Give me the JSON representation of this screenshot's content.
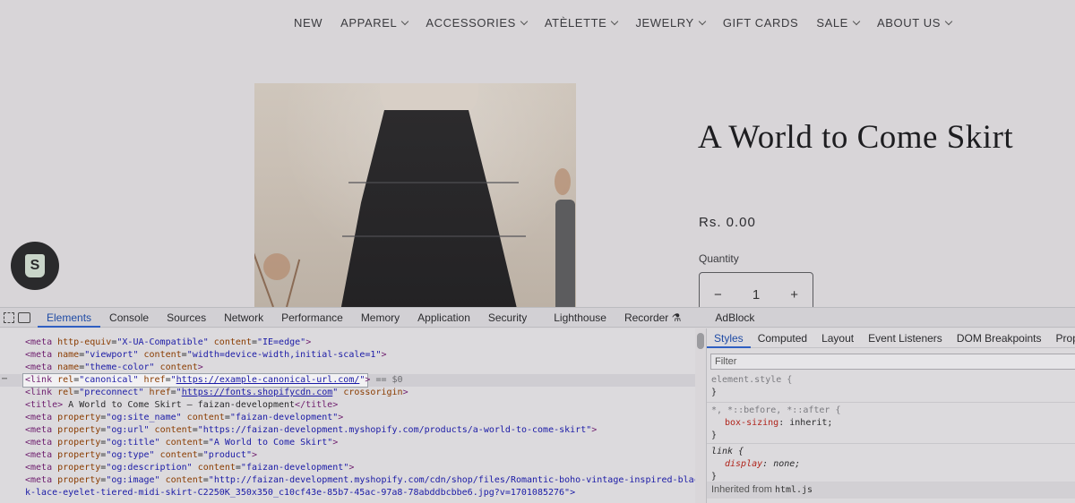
{
  "nav": {
    "items": [
      {
        "label": "NEW",
        "dropdown": false
      },
      {
        "label": "APPAREL",
        "dropdown": true
      },
      {
        "label": "ACCESSORIES",
        "dropdown": true
      },
      {
        "label": "ATÈLETTE",
        "dropdown": true
      },
      {
        "label": "JEWELRY",
        "dropdown": true
      },
      {
        "label": "GIFT CARDS",
        "dropdown": false
      },
      {
        "label": "SALE",
        "dropdown": true
      },
      {
        "label": "ABOUT US",
        "dropdown": true
      }
    ]
  },
  "product": {
    "title": "A World to Come Skirt",
    "price": "Rs. 0.00",
    "quantity_label": "Quantity",
    "quantity_value": "1",
    "minus": "−",
    "plus": "+"
  },
  "devtools": {
    "tabs": [
      "Elements",
      "Console",
      "Sources",
      "Network",
      "Performance",
      "Memory",
      "Application",
      "Security",
      "Lighthouse",
      "Recorder ⚗",
      "AdBlock"
    ],
    "active_tab": "Elements",
    "elements": {
      "lines": [
        {
          "tag": "meta",
          "attrs": [
            [
              "http-equiv",
              "X-UA-Compatible"
            ],
            [
              "content",
              "IE=edge"
            ]
          ]
        },
        {
          "tag": "meta",
          "attrs": [
            [
              "name",
              "viewport"
            ],
            [
              "content",
              "width=device-width,initial-scale=1"
            ]
          ]
        },
        {
          "tag": "meta",
          "attrs": [
            [
              "name",
              "theme-color"
            ],
            [
              "content",
              ""
            ]
          ]
        },
        {
          "tag": "link",
          "attrs": [
            [
              "rel",
              "canonical"
            ],
            [
              "href",
              "https://example-canonical-url.com/"
            ]
          ],
          "selected": true,
          "suffix": "== $0"
        },
        {
          "tag": "link",
          "attrs": [
            [
              "rel",
              "preconnect"
            ],
            [
              "href",
              "https://fonts.shopifycdn.com"
            ]
          ],
          "extra": "crossorigin"
        },
        {
          "tag": "title",
          "text": " A World to Come Skirt – faizan-development"
        },
        {
          "tag": "meta",
          "attrs": [
            [
              "property",
              "og:site_name"
            ],
            [
              "content",
              "faizan-development"
            ]
          ]
        },
        {
          "tag": "meta",
          "attrs": [
            [
              "property",
              "og:url"
            ],
            [
              "content",
              "https://faizan-development.myshopify.com/products/a-world-to-come-skirt"
            ]
          ]
        },
        {
          "tag": "meta",
          "attrs": [
            [
              "property",
              "og:title"
            ],
            [
              "content",
              "A World to Come Skirt"
            ]
          ]
        },
        {
          "tag": "meta",
          "attrs": [
            [
              "property",
              "og:type"
            ],
            [
              "content",
              "product"
            ]
          ]
        },
        {
          "tag": "meta",
          "attrs": [
            [
              "property",
              "og:description"
            ],
            [
              "content",
              "faizan-development"
            ]
          ]
        },
        {
          "tag": "meta",
          "attrs": [
            [
              "property",
              "og:image"
            ],
            [
              "content",
              "http://faizan-development.myshopify.com/cdn/shop/files/Romantic-boho-vintage-inspired-blac"
            ]
          ]
        },
        {
          "continuation": "k-lace-eyelet-tiered-midi-skirt-C2250K_350x350_c10cf43e-85b7-45ac-97a8-78abddbcbbe6.jpg?v=1701085276\">"
        }
      ]
    },
    "styles": {
      "tabs": [
        "Styles",
        "Computed",
        "Layout",
        "Event Listeners",
        "DOM Breakpoints",
        "Properties"
      ],
      "active_tab": "Styles",
      "filter_placeholder": "Filter",
      "rules": {
        "element_style": "element.style {",
        "close": "}",
        "universal_selector": "*, *::before, *::after {",
        "universal_prop": "box-sizing",
        "universal_val": "inherit;",
        "link_selector": "link {",
        "link_prop": "display",
        "link_val": "none;"
      },
      "inherited_label": "Inherited from",
      "inherited_from": "html.js"
    }
  },
  "colors": {
    "accent": "#1f4ba5",
    "tag": "#6d1c6d",
    "attr_name": "#8a3c00",
    "attr_value": "#1a1aa6"
  }
}
